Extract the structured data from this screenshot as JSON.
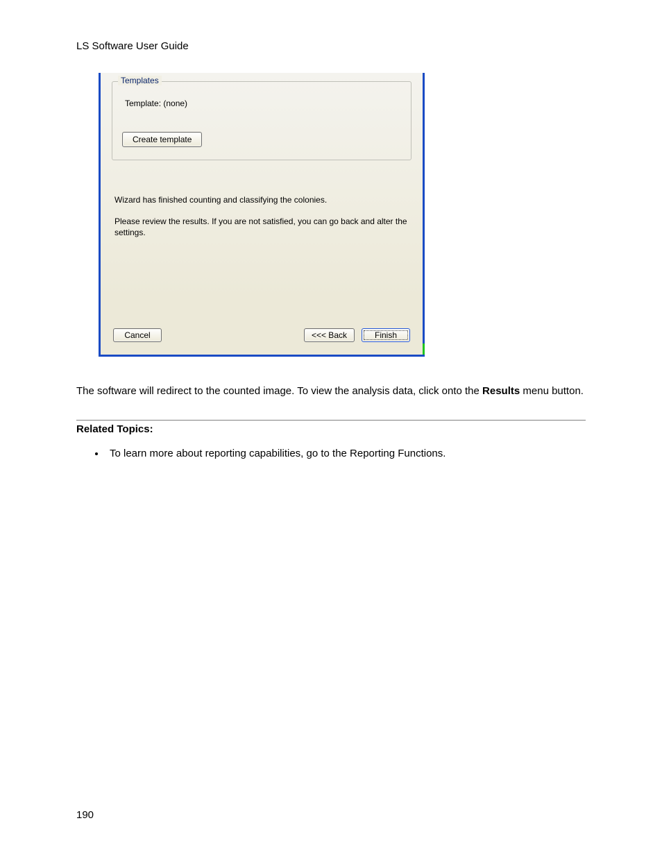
{
  "doc": {
    "header": "LS Software User Guide",
    "page_number": "190"
  },
  "dialog": {
    "templates": {
      "legend": "Templates",
      "template_label": "Template: (none)",
      "create_button": "Create template"
    },
    "message_line1": "Wizard has finished counting and classifying the colonies.",
    "message_line2": "Please review the results. If you are not satisfied, you can go back and alter the settings.",
    "buttons": {
      "cancel": "Cancel",
      "back": "<<< Back",
      "finish": "Finish"
    }
  },
  "body": {
    "text_pre": "The software will redirect to the counted image. To view the analysis data, click onto the ",
    "text_bold": "Results",
    "text_post": " menu button.",
    "related_heading": "Related Topics:",
    "related_items": [
      "To learn more about reporting capabilities, go to the Reporting Functions."
    ]
  }
}
